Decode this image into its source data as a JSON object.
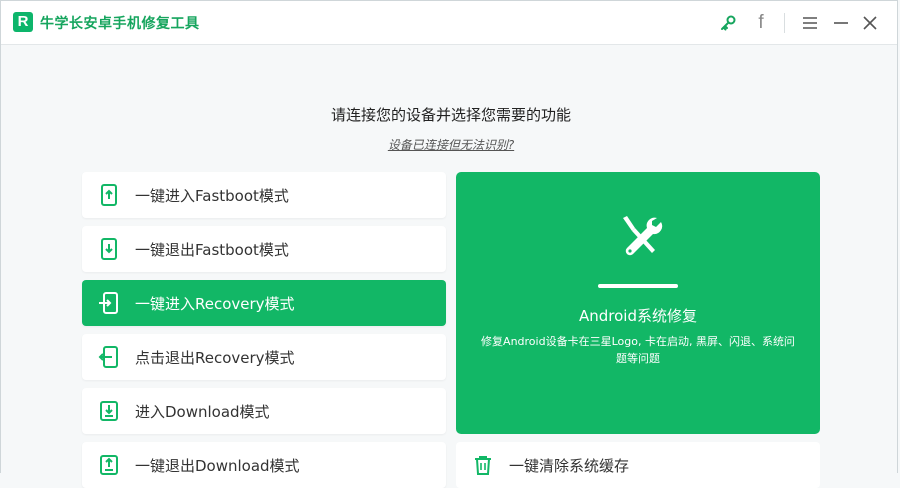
{
  "app": {
    "title": "牛学长安卓手机修复工具",
    "logo_letter": "R"
  },
  "titlebar": {
    "icons": [
      "key-icon",
      "facebook-icon",
      "menu-icon",
      "minimize-icon",
      "close-icon"
    ],
    "facebook_glyph": "f"
  },
  "main": {
    "heading": "请连接您的设备并选择您需要的功能",
    "subheading": "设备已连接但无法识别?"
  },
  "menu": {
    "items": [
      {
        "label": "一键进入Fastboot模式",
        "icon": "phone-arrow-up-icon"
      },
      {
        "label": "一键退出Fastboot模式",
        "icon": "phone-arrow-down-icon"
      },
      {
        "label": "一键进入Recovery模式",
        "icon": "phone-enter-icon",
        "active": true
      },
      {
        "label": "点击退出Recovery模式",
        "icon": "phone-exit-icon"
      },
      {
        "label": "进入Download模式",
        "icon": "download-icon"
      },
      {
        "label": "一键退出Download模式",
        "icon": "upload-icon"
      }
    ]
  },
  "feature": {
    "title": "Android系统修复",
    "description": "修复Android设备卡在三星Logo, 卡在启动, 黑屏、闪退、系统问题等问题",
    "icon": "repair-tools-icon"
  },
  "cache": {
    "label": "一键清除系统缓存",
    "icon": "trash-icon"
  },
  "colors": {
    "accent": "#12b766",
    "title": "#16a55e",
    "background": "#f6f8f9"
  }
}
